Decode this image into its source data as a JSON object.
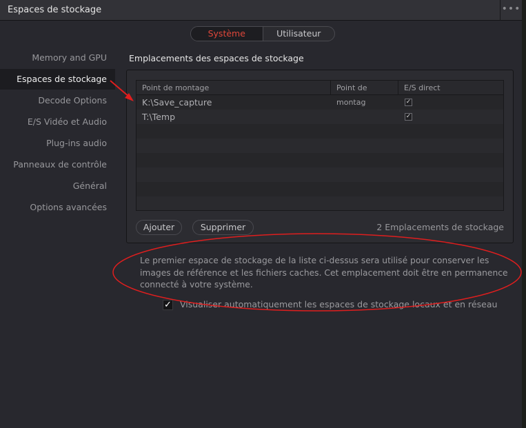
{
  "window": {
    "title": "Espaces de stockage",
    "more_icon": "•••"
  },
  "segmented": {
    "system": "Système",
    "user": "Utilisateur"
  },
  "sidebar": {
    "items": [
      {
        "label": "Memory and GPU"
      },
      {
        "label": "Espaces de stockage",
        "selected": true
      },
      {
        "label": "Decode Options"
      },
      {
        "label": "E/S Vidéo et Audio"
      },
      {
        "label": "Plug-ins audio"
      },
      {
        "label": "Panneaux de contrôle"
      },
      {
        "label": "Général"
      },
      {
        "label": "Options avancées"
      }
    ]
  },
  "panel": {
    "heading": "Emplacements des espaces de stockage",
    "table": {
      "columns": [
        "Point de montage",
        "Point de montag",
        "E/S direct"
      ],
      "rows": [
        {
          "mount": "K:\\Save_capture",
          "direct_io": true
        },
        {
          "mount": "T:\\Temp",
          "direct_io": true
        }
      ]
    },
    "add_label": "Ajouter",
    "remove_label": "Supprimer",
    "count_label": "2 Emplacements de stockage"
  },
  "info_text": "Le premier espace de stockage de la liste ci-dessus sera utilisé pour conserver les images de référence et les fichiers caches. Cet emplacement doit être en permanence connecté à votre système.",
  "auto_scan": {
    "checked": true,
    "label": "Visualiser automatiquement les espaces de stockage locaux et en réseau"
  },
  "colors": {
    "accent": "#e0473a",
    "annotation": "#e01e1e"
  }
}
